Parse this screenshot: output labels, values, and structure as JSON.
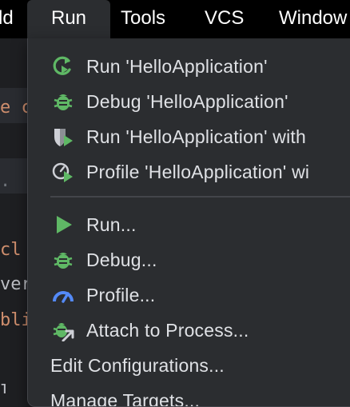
{
  "menubar": {
    "items": [
      "ld",
      "Run",
      "Tools",
      "VCS",
      "Window"
    ],
    "active": "Run"
  },
  "editor": {
    "code_fragments": [
      {
        "text": "e c",
        "color": "#cf8e6d"
      },
      {
        "text": "  .",
        "color": "#6f737a"
      },
      {
        "text": " cl",
        "color": "#cf8e6d"
      },
      {
        "text": "ver",
        "color": "#bcbec4"
      },
      {
        "text": "bli",
        "color": "#cf8e6d"
      },
      {
        "text": "  l",
        "color": "#bcbec4"
      }
    ]
  },
  "run_menu": {
    "group1": [
      {
        "icon": "rerun-icon",
        "label": "Run 'HelloApplication'"
      },
      {
        "icon": "debug-bug-icon",
        "label": "Debug 'HelloApplication'"
      },
      {
        "icon": "run-with-coverage-icon",
        "label": "Run 'HelloApplication' with"
      },
      {
        "icon": "profile-run-icon",
        "label": "Profile 'HelloApplication' wi"
      }
    ],
    "group2": [
      {
        "icon": "run-play-icon",
        "label": "Run..."
      },
      {
        "icon": "debug-bug-icon",
        "label": "Debug..."
      },
      {
        "icon": "profiler-gauge-icon",
        "label": "Profile..."
      },
      {
        "icon": "attach-debugger-icon",
        "label": "Attach to Process..."
      },
      {
        "icon": "",
        "label": "Edit Configurations..."
      },
      {
        "icon": "",
        "label": "Manage Targets..."
      }
    ],
    "colors": {
      "menu_bg": "#2b2d30",
      "text": "#dfe1e5",
      "run_green": "#5fb865",
      "debug_green": "#5fb865",
      "profile_blue": "#548af7",
      "icon_grey": "#ced0d6"
    }
  }
}
